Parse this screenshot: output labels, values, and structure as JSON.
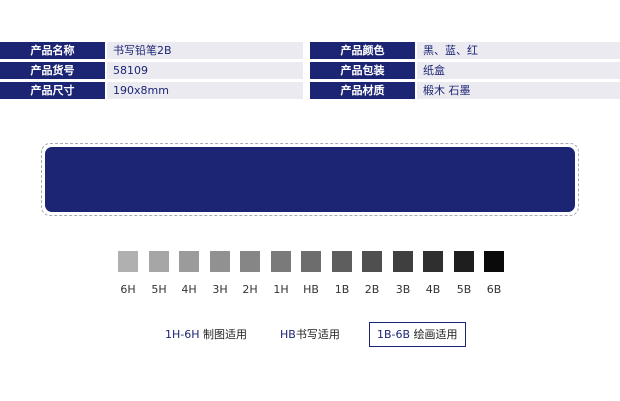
{
  "specs": [
    {
      "label1": "产品名称",
      "value1": "书写铅笔2B",
      "label2": "产品颜色",
      "value2": "黑、蓝、红"
    },
    {
      "label1": "产品货号",
      "value1": "58109",
      "label2": "产品包装",
      "value2": "纸盒"
    },
    {
      "label1": "产品尺寸",
      "value1": "190x8mm",
      "label2": "产品材质",
      "value2": "椴木 石墨"
    }
  ],
  "grades": [
    {
      "name": "6H",
      "color": "#b0b0b0"
    },
    {
      "name": "5H",
      "color": "#a6a6a6"
    },
    {
      "name": "4H",
      "color": "#9b9b9b"
    },
    {
      "name": "3H",
      "color": "#919191"
    },
    {
      "name": "2H",
      "color": "#868686"
    },
    {
      "name": "1H",
      "color": "#7a7a7a"
    },
    {
      "name": "HB",
      "color": "#6d6d6d"
    },
    {
      "name": "1B",
      "color": "#5e5e5e"
    },
    {
      "name": "2B",
      "color": "#4f4f4f"
    },
    {
      "name": "3B",
      "color": "#3f3f3f"
    },
    {
      "name": "4B",
      "color": "#2f2f2f"
    },
    {
      "name": "5B",
      "color": "#1e1e1e"
    },
    {
      "name": "6B",
      "color": "#0a0a0a"
    }
  ],
  "legend": [
    {
      "code": "1H-6H",
      "desc": "制图适用"
    },
    {
      "code": "HB",
      "desc": "书写适用"
    },
    {
      "code": "1B-6B",
      "desc": "绘画适用"
    }
  ],
  "colors": {
    "brand": "#1c2574",
    "row_bg": "#eceaf1"
  }
}
